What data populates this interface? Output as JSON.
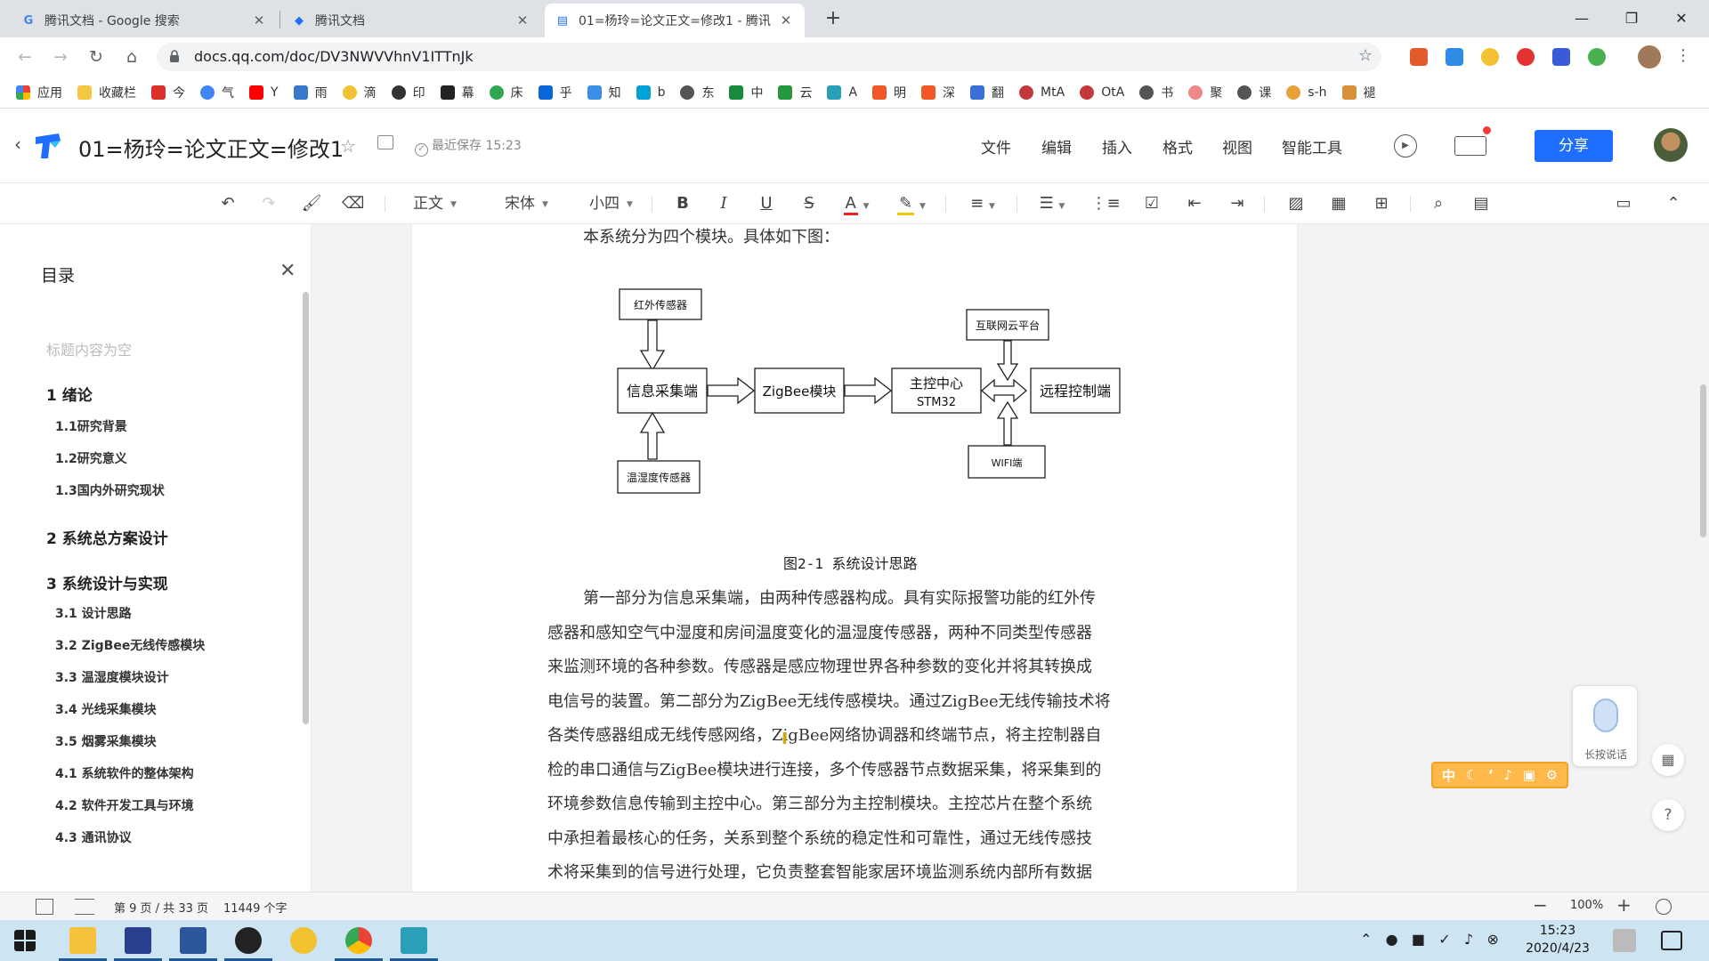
{
  "browser": {
    "tabs": [
      {
        "title": "腾讯文档 - Google 搜索",
        "favicon": "google-g"
      },
      {
        "title": "腾讯文档",
        "favicon": "tencent-docs"
      },
      {
        "title": "01=杨玲=论文正文=修改1 - 腾讯",
        "favicon": "doc-icon"
      }
    ],
    "url": "docs.qq.com/doc/DV3NWVVhnV1ITTnJk",
    "bookmarks": [
      "应用",
      "收藏栏",
      "今",
      "气",
      "Y",
      "雨",
      "滴",
      "印",
      "幕",
      "床",
      "乎",
      "知",
      "b",
      "东",
      "中",
      "云",
      "A",
      "明",
      "深",
      "翻",
      "MtA",
      "OtA",
      "书",
      "聚",
      "课",
      "s-h",
      "褪"
    ]
  },
  "app": {
    "doc_title": "01=杨玲=论文正文=修改1",
    "save_status": "最近保存 15:23",
    "menus": [
      "文件",
      "编辑",
      "插入",
      "格式",
      "视图",
      "智能工具"
    ],
    "share_label": "分享",
    "accent": "#1e6fff"
  },
  "format_toolbar": {
    "style": "正文",
    "font": "宋体",
    "size": "小四"
  },
  "outline": {
    "title": "目录",
    "empty_heading": "标题内容为空",
    "items": [
      {
        "level": 1,
        "text": "1 绪论"
      },
      {
        "level": 2,
        "text": "1.1研究背景"
      },
      {
        "level": 2,
        "text": "1.2研究意义"
      },
      {
        "level": 2,
        "text": "1.3国内外研究现状"
      },
      {
        "level": 1,
        "text": "2 系统总方案设计"
      },
      {
        "level": 1,
        "text": "3 系统设计与实现"
      },
      {
        "level": 2,
        "text": "3.1 设计思路"
      },
      {
        "level": 2,
        "text": "3.2 ZigBee无线传感模块"
      },
      {
        "level": 2,
        "text": "3.3 温湿度模块设计"
      },
      {
        "level": 2,
        "text": "3.4 光线采集模块"
      },
      {
        "level": 2,
        "text": "3.5 烟雾采集模块"
      },
      {
        "level": 2,
        "text": "4.1 系统软件的整体架构"
      },
      {
        "level": 2,
        "text": "4.2 软件开发工具与环境"
      },
      {
        "level": 2,
        "text": "4.3 通讯协议"
      }
    ]
  },
  "document": {
    "intro": "本系统分为四个模块。具体如下图：",
    "diagram": {
      "infrared": "红外传感器",
      "collector": "信息采集端",
      "temp_humidity": "温湿度传感器",
      "zigbee": "ZigBee模块",
      "main_control_line1": "主控中心",
      "main_control_line2": "STM32",
      "cloud": "互联网云平台",
      "remote": "远程控制端",
      "wifi": "WIFI端"
    },
    "caption": "图2-1 系统设计思路",
    "body_lines": [
      "第一部分为信息采集端，由两种传感器构成。具有实际报警功能的红外传",
      "感器和感知空气中湿度和房间温度变化的温湿度传感器，两种不同类型传感器",
      "来监测环境的各种参数。传感器是感应物理世界各种参数的变化并将其转换成",
      "电信号的装置。第二部分为ZigBee无线传感模块。通过ZigBee无线传输技术将",
      "各类传感器组成无线传感网络，ZigBee网络协调器和终端节点，将主控制器自",
      "检的串口通信与ZigBee模块进行连接，多个传感器节点数据采集，将采集到的",
      "环境参数信息传输到主控中心。第三部分为主控制模块。主控芯片在整个系统",
      "中承担着最核心的任务，关系到整个系统的稳定性和可靠性，通过无线传感技",
      "术将采集到的信号进行处理，它负责整套智能家居环境监测系统内部所有数据"
    ]
  },
  "widgets": {
    "voice_label": "长按说话",
    "ime_label": "中",
    "help_label": "?"
  },
  "statusbar": {
    "pages": "第 9 页 / 共 33 页",
    "words": "11449 个字",
    "zoom": "100%"
  },
  "taskbar": {
    "time": "15:23",
    "date": "2020/4/23"
  }
}
